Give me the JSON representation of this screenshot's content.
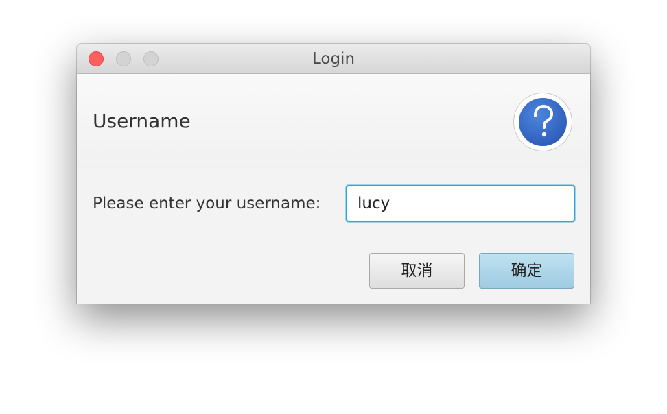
{
  "window": {
    "title": "Login"
  },
  "header": {
    "text": "Username",
    "icon": "question-mark-icon"
  },
  "form": {
    "prompt": "Please enter your username:",
    "username_value": "lucy"
  },
  "buttons": {
    "cancel_label": "取消",
    "ok_label": "确定"
  },
  "colors": {
    "close_button": "#fc605c",
    "help_icon": "#3a6cc8",
    "focus_ring": "#2ea5dd",
    "default_button": "#a9d4ea"
  }
}
